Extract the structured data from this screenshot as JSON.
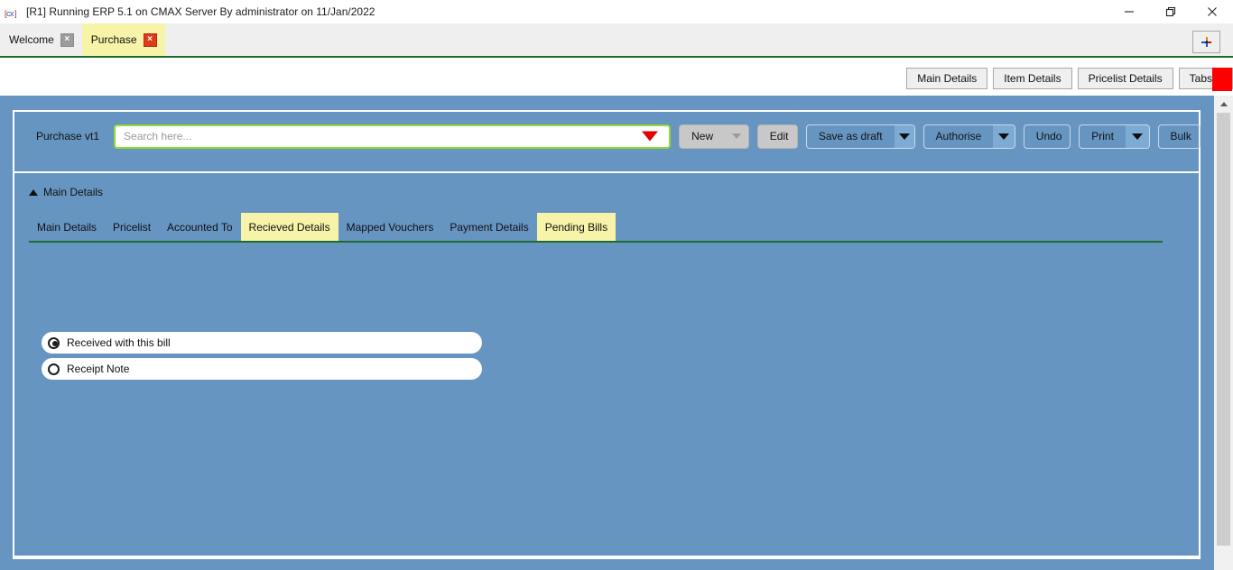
{
  "window": {
    "icon": "cx-app-icon",
    "title": "[R1] Running ERP 5.1 on CMAX Server By administrator on 11/Jan/2022",
    "controls": {
      "minimize": "minimize-icon",
      "maximize": "restore-icon",
      "close": "close-icon"
    }
  },
  "tabstrip": {
    "tabs": [
      {
        "label": "Welcome",
        "close": "×",
        "active": false
      },
      {
        "label": "Purchase",
        "close": "×",
        "active": true
      }
    ],
    "add_tab_label": "+"
  },
  "sec_toolbar": {
    "buttons": [
      {
        "label": "Main Details"
      },
      {
        "label": "Item Details"
      },
      {
        "label": "Pricelist Details"
      },
      {
        "label": "Tabs"
      }
    ]
  },
  "search_row": {
    "entity_label": "Purchase vt1",
    "search_placeholder": "Search here...",
    "search_value": "",
    "dropdown_icon": "red-caret-down-icon",
    "actions": [
      {
        "label": "New",
        "style": "grey",
        "split": true,
        "split_state": "disabled"
      },
      {
        "label": "Edit",
        "style": "grey",
        "split": false
      },
      {
        "label": "Save as draft",
        "style": "ghost",
        "split": true,
        "split_state": "enabled"
      },
      {
        "label": "Authorise",
        "style": "ghost",
        "split": true,
        "split_state": "enabled"
      },
      {
        "label": "Undo",
        "style": "ghost",
        "split": false
      },
      {
        "label": "Print",
        "style": "ghost",
        "split": true,
        "split_state": "enabled"
      },
      {
        "label": "Bulk",
        "style": "ghost",
        "split": false
      }
    ]
  },
  "details": {
    "section_title": "Main Details",
    "collapse_icon": "caret-up-icon",
    "tabs": [
      {
        "label": "Main Details",
        "highlighted": false
      },
      {
        "label": "Pricelist",
        "highlighted": false
      },
      {
        "label": "Accounted To",
        "highlighted": false
      },
      {
        "label": "Recieved Details",
        "highlighted": true
      },
      {
        "label": "Mapped Vouchers",
        "highlighted": false
      },
      {
        "label": "Payment Details",
        "highlighted": false
      },
      {
        "label": "Pending Bills",
        "highlighted": true
      }
    ],
    "radio_options": [
      {
        "label": "Received with this bill",
        "selected": true,
        "wide": true
      },
      {
        "label": "Receipt Note",
        "selected": false,
        "wide": false
      }
    ]
  },
  "scrollbar": {
    "up_icon": "scroll-up-arrow-icon"
  },
  "colors": {
    "workspace_blue": "#6795c2",
    "tab_highlight": "#f7f3a8",
    "accent_green": "#1d6b2d",
    "search_border_green": "#8ddc2f",
    "dropdown_red": "#e00000",
    "marker_red": "#ff0000",
    "close_red": "#e03a18",
    "button_grey": "#c8c8c8",
    "chrome_grey": "#efefef"
  }
}
